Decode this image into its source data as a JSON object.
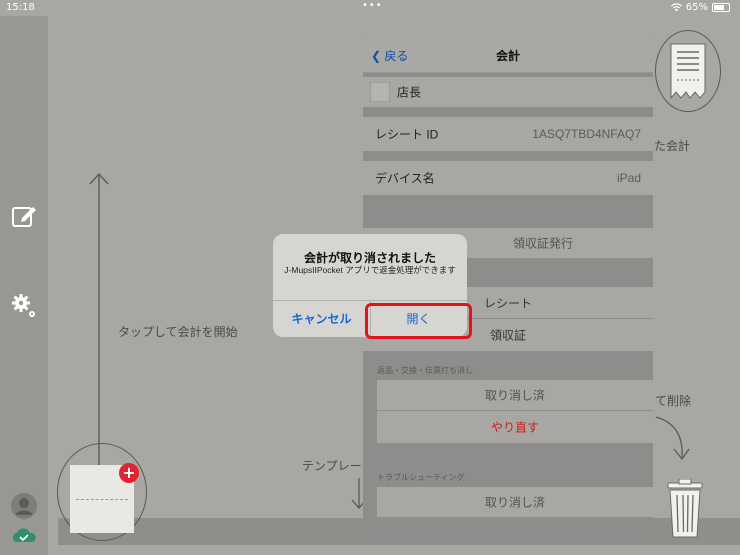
{
  "status": {
    "time": "15:18",
    "dots": "•••",
    "battery": "65%"
  },
  "canvas": {
    "hint_start": "タップして会計を開始",
    "hint_template": "テンプレート",
    "hint_delete": "て削除",
    "hint_receipt": "た会計"
  },
  "panel": {
    "back_label": "戻る",
    "title": "会計",
    "staff_label": "店長",
    "receipt_id_label": "レシート ID",
    "receipt_id_value": "1ASQ7TBD4NFAQ7",
    "device_label": "デバイス名",
    "device_value": "iPad",
    "issue_label": "領収証発行",
    "receipt_btn": "レシート",
    "invoice_btn": "領収証",
    "returns_section": "返品・交換・伝票打ち消し",
    "cancelled_1": "取り消し済",
    "redo": "やり直す",
    "trouble_section": "トラブルシューティング",
    "cancelled_2": "取り消し済"
  },
  "dialog": {
    "title": "会計が取り消されました",
    "message": "J-MupsIIPocket アプリで返金処理ができます",
    "cancel": "キャンセル",
    "open": "開く"
  },
  "colors": {
    "accent": "#1766d6",
    "danger": "#d0221f",
    "highlight": "#e0141b"
  }
}
